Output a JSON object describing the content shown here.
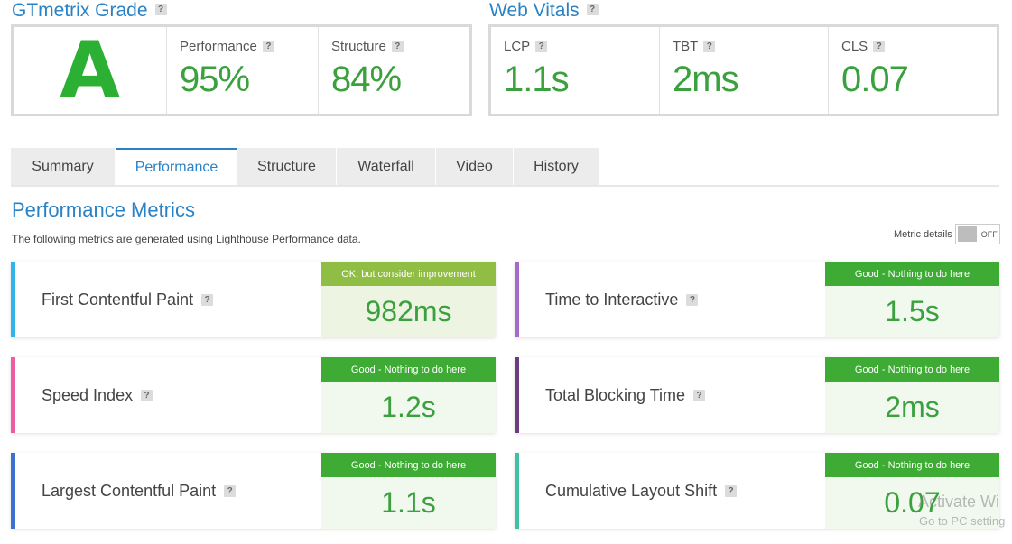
{
  "colors": {
    "accent_blue": "#2a82c6",
    "grade_green": "#2cb034",
    "value_green": "#3aa13e",
    "badge_good": "#3eac34",
    "badge_ok": "#90be44",
    "val_bg_good": "#f1f9ef",
    "val_bg_ok": "#eef4e2"
  },
  "grade": {
    "title": "GTmetrix Grade",
    "help": "?",
    "letter": "A",
    "performance_label": "Performance",
    "performance_value": "95%",
    "structure_label": "Structure",
    "structure_value": "84%"
  },
  "web_vitals": {
    "title": "Web Vitals",
    "help": "?",
    "items": [
      {
        "label": "LCP",
        "value": "1.1s"
      },
      {
        "label": "TBT",
        "value": "2ms"
      },
      {
        "label": "CLS",
        "value": "0.07"
      }
    ]
  },
  "tabs": [
    {
      "label": "Summary"
    },
    {
      "label": "Performance"
    },
    {
      "label": "Structure"
    },
    {
      "label": "Waterfall"
    },
    {
      "label": "Video"
    },
    {
      "label": "History"
    }
  ],
  "active_tab": "Performance",
  "performance_metrics": {
    "title": "Performance Metrics",
    "subtitle": "The following metrics are generated using Lighthouse Performance data.",
    "details_label": "Metric details",
    "toggle_state": "OFF",
    "cards": [
      {
        "name": "First Contentful Paint",
        "badge": "OK, but consider improvement",
        "value": "982ms",
        "bar_color": "#31b5e8",
        "status": "ok"
      },
      {
        "name": "Time to Interactive",
        "badge": "Good - Nothing to do here",
        "value": "1.5s",
        "bar_color": "#a66bc9",
        "status": "good"
      },
      {
        "name": "Speed Index",
        "badge": "Good - Nothing to do here",
        "value": "1.2s",
        "bar_color": "#ec5ea1",
        "status": "good"
      },
      {
        "name": "Total Blocking Time",
        "badge": "Good - Nothing to do here",
        "value": "2ms",
        "bar_color": "#6c3b80",
        "status": "good"
      },
      {
        "name": "Largest Contentful Paint",
        "badge": "Good - Nothing to do here",
        "value": "1.1s",
        "bar_color": "#3c71d0",
        "status": "good"
      },
      {
        "name": "Cumulative Layout Shift",
        "badge": "Good - Nothing to do here",
        "value": "0.07",
        "bar_color": "#3ec1a4",
        "status": "good"
      }
    ]
  },
  "watermark": {
    "line1": "Activate Wi",
    "line2": "Go to PC setting"
  }
}
